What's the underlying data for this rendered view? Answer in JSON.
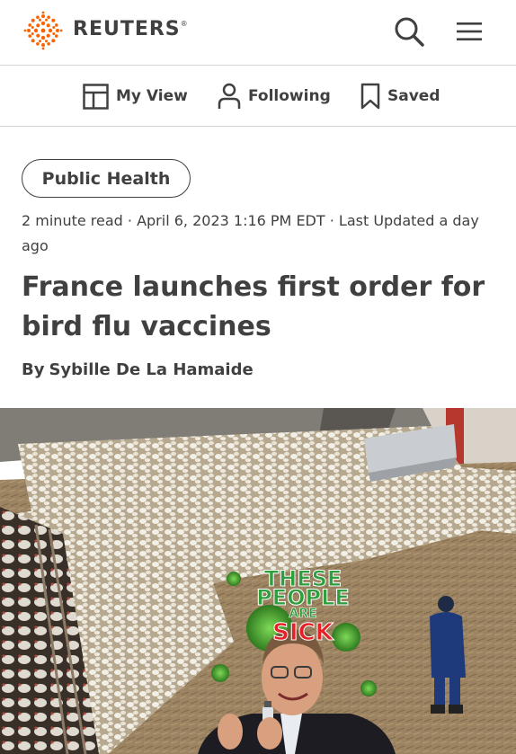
{
  "header": {
    "brand": "REUTERS",
    "trademark": "®"
  },
  "nav": {
    "items": [
      {
        "label": "My View",
        "icon": "layout-icon"
      },
      {
        "label": "Following",
        "icon": "person-icon"
      },
      {
        "label": "Saved",
        "icon": "bookmark-icon"
      }
    ]
  },
  "article": {
    "category": "Public Health",
    "meta": "2 minute read · April 6, 2023 1:16 PM EDT · Last Updated a day ago",
    "title": "France launches first order for bird flu vaccines",
    "byline_prefix": "By",
    "author": "Sybille De La Hamaide"
  },
  "photo": {
    "overlay_lines": [
      "THESE",
      "PEOPLE",
      "ARE",
      "SICK"
    ]
  },
  "colors": {
    "brand_orange": "#fa6400",
    "text": "#404040",
    "divider": "#d6d6d6"
  }
}
